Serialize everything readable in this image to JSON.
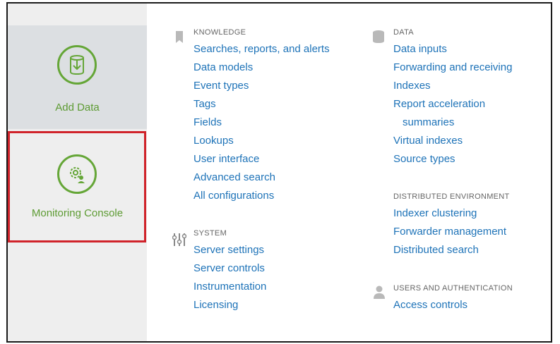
{
  "tiles": {
    "add_data": {
      "label": "Add Data",
      "icon": "database-import-icon"
    },
    "monitoring_console": {
      "label": "Monitoring Console",
      "icon": "gear-user-icon"
    }
  },
  "knowledge": {
    "heading": "KNOWLEDGE",
    "icon": "bookmark-icon",
    "links": [
      "Searches, reports, and alerts",
      "Data models",
      "Event types",
      "Tags",
      "Fields",
      "Lookups",
      "User interface",
      "Advanced search",
      "All configurations"
    ]
  },
  "system": {
    "heading": "SYSTEM",
    "icon": "sliders-icon",
    "links": [
      "Server settings",
      "Server controls",
      "Instrumentation",
      "Licensing"
    ]
  },
  "data": {
    "heading": "DATA",
    "icon": "database-icon",
    "links": [
      "Data inputs",
      "Forwarding and receiving",
      "Indexes",
      "Report acceleration",
      "summaries",
      "Virtual indexes",
      "Source types"
    ]
  },
  "distributed": {
    "heading": "DISTRIBUTED ENVIRONMENT",
    "links": [
      "Indexer clustering",
      "Forwarder management",
      "Distributed search"
    ]
  },
  "users": {
    "heading": "USERS AND AUTHENTICATION",
    "icon": "user-icon",
    "links": [
      "Access controls"
    ]
  },
  "colors": {
    "link": "#1e73b8",
    "accent_green": "#65a637",
    "highlight_red": "#d0232a",
    "sidebar_bg": "#eeeeee",
    "active_tile_bg": "#dcdfe2"
  }
}
